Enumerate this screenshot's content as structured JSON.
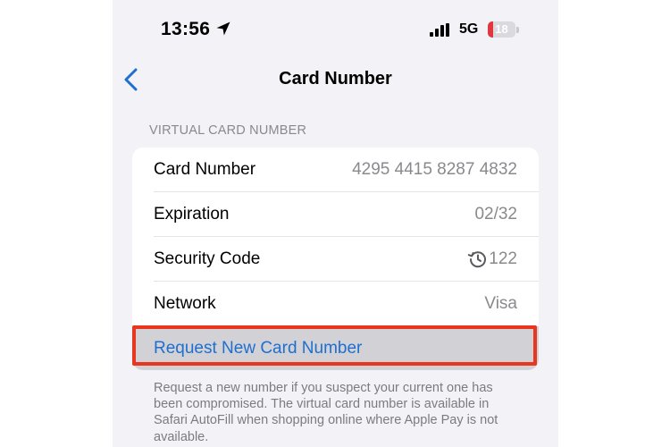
{
  "status_bar": {
    "time": "13:56",
    "network": "5G",
    "battery_level": "18",
    "battery_fraction": 0.18,
    "icons": [
      "location-arrow-icon",
      "signal-icon",
      "battery-icon"
    ]
  },
  "nav": {
    "back_icon": "chevron-left-icon",
    "title": "Card Number"
  },
  "section": {
    "header": "VIRTUAL CARD NUMBER",
    "rows": [
      {
        "label": "Card Number",
        "value": "4295 4415 8287 4832"
      },
      {
        "label": "Expiration",
        "value": "02/32"
      },
      {
        "label": "Security Code",
        "value": "122",
        "icon": "refresh-clock-icon"
      },
      {
        "label": "Network",
        "value": "Visa"
      }
    ],
    "action_label": "Request New Card Number",
    "footer": "Request a new number if you suspect your current one has been compromised. The virtual card number is available in Safari AutoFill when shopping online where Apple Pay is not available."
  },
  "colors": {
    "accent": "#1f6fd0",
    "highlight": "#e8361f",
    "background": "#f2f2f7",
    "battery_low": "#e0383e"
  }
}
